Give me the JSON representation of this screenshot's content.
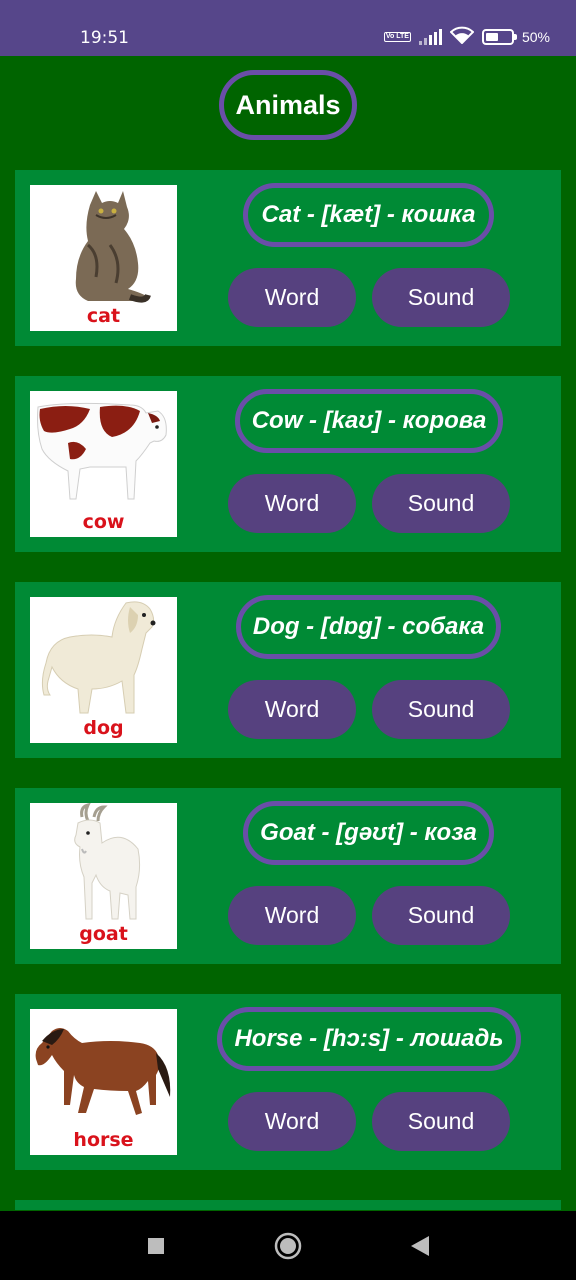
{
  "status": {
    "time": "19:51",
    "volte": "Vo LTE",
    "battery_level": 50,
    "battery_text": "50%"
  },
  "app": {
    "title": "Animals"
  },
  "animals": [
    {
      "caption": "cat",
      "phrase": "Cat - [kæt] - кошка",
      "word_label": "Word",
      "sound_label": "Sound"
    },
    {
      "caption": "cow",
      "phrase": "Cow - [kaʊ] - корова",
      "word_label": "Word",
      "sound_label": "Sound"
    },
    {
      "caption": "dog",
      "phrase": "Dog - [dɒg] - собака",
      "word_label": "Word",
      "sound_label": "Sound"
    },
    {
      "caption": "goat",
      "phrase": "Goat - [gəʊt] - коза",
      "word_label": "Word",
      "sound_label": "Sound"
    },
    {
      "caption": "horse",
      "phrase": "Horse - [hɔ:s] - лошадь",
      "word_label": "Word",
      "sound_label": "Sound"
    }
  ],
  "colors": {
    "background": "#006400",
    "card": "#008a35",
    "accent_border": "#6a4ea8",
    "button": "#56417f",
    "status_bar": "#56468a",
    "caption": "#d9121b"
  },
  "nav": {
    "icons": [
      "square-recents-icon",
      "circle-home-icon",
      "triangle-back-icon"
    ]
  }
}
